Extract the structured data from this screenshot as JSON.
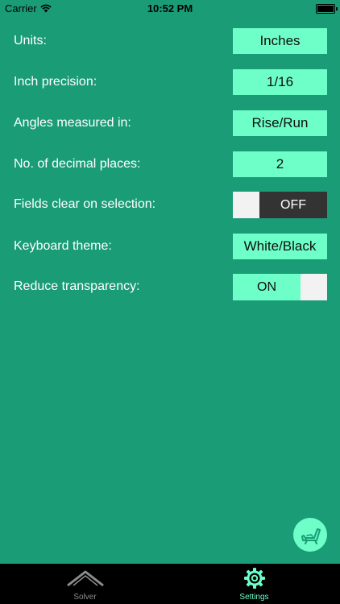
{
  "status_bar": {
    "carrier": "Carrier",
    "time": "10:52 PM",
    "wifi_icon": "wifi-icon",
    "battery_icon": "battery-icon",
    "battery_level": 1.0
  },
  "settings": {
    "units": {
      "label": "Units:",
      "value": "Inches"
    },
    "inch_precision": {
      "label": "Inch precision:",
      "value": "1/16"
    },
    "angles": {
      "label": "Angles measured in:",
      "value": "Rise/Run"
    },
    "decimal_places": {
      "label": "No. of decimal places:",
      "value": "2"
    },
    "fields_clear": {
      "label": "Fields clear on selection:",
      "state": "OFF"
    },
    "keyboard_theme": {
      "label": "Keyboard theme:",
      "value": "White/Black"
    },
    "reduce_transparency": {
      "label": "Reduce transparency:",
      "state": "ON"
    }
  },
  "fab": {
    "icon": "chair-icon"
  },
  "tab_bar": {
    "tabs": [
      {
        "label": "Solver",
        "icon": "roof-icon",
        "selected": false
      },
      {
        "label": "Settings",
        "icon": "gear-icon",
        "selected": true
      }
    ]
  },
  "colors": {
    "background": "#1a9c77",
    "accent": "#6effc9",
    "toggle_dark": "#333333",
    "tab_bar": "#000000"
  }
}
